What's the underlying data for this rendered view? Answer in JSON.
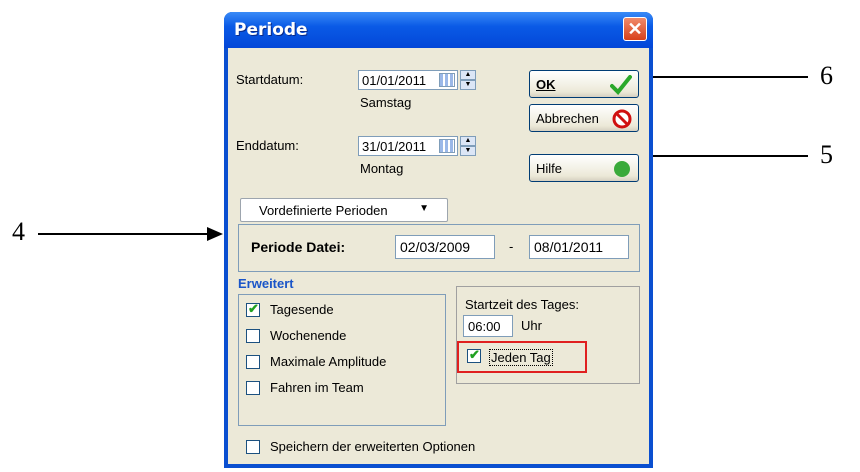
{
  "callouts": {
    "c4": "4",
    "c5": "5",
    "c6": "6"
  },
  "window": {
    "title": "Periode",
    "close_glyph": "✕"
  },
  "start": {
    "label": "Startdatum:",
    "value": "01/01/2011",
    "weekday": "Samstag"
  },
  "end": {
    "label": "Enddatum:",
    "value": "31/01/2011",
    "weekday": "Montag"
  },
  "buttons": {
    "ok": "OK",
    "cancel": "Abbrechen",
    "help": "Hilfe"
  },
  "predefined": {
    "value": "Vordefinierte Perioden",
    "arrow": "▼"
  },
  "periode_datei": {
    "label": "Periode Datei:",
    "from": "02/03/2009",
    "sep": "-",
    "to": "08/01/2011"
  },
  "erweitert": {
    "title": "Erweitert",
    "options": [
      {
        "label": "Tagesende",
        "checked": true
      },
      {
        "label": "Wochenende",
        "checked": false
      },
      {
        "label": "Maximale Amplitude",
        "checked": false
      },
      {
        "label": "Fahren im Team",
        "checked": false
      }
    ]
  },
  "startzeit": {
    "label": "Startzeit des Tages:",
    "value": "06:00",
    "unit": "Uhr",
    "jeden_tag": "Jeden Tag",
    "jeden_checked": true
  },
  "save_options": {
    "label": "Speichern der erweiterten Optionen",
    "checked": false
  },
  "colors": {
    "title_bar": "#0a5ae6",
    "dialog_bg": "#ece9d8",
    "accent_red": "#e02020",
    "check_green": "#21a121"
  },
  "icons": {
    "ok": "checkmark-icon",
    "cancel": "no-entry-icon",
    "help": "help-icon",
    "calendar": "calendar-icon"
  }
}
